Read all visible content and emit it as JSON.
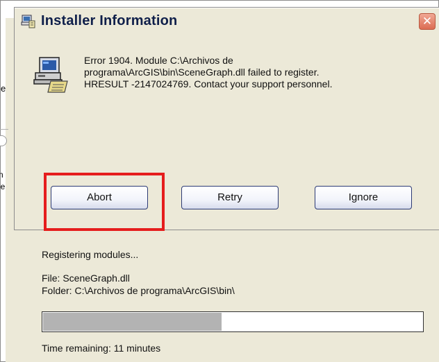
{
  "dialog": {
    "title": "Installer Information",
    "close_glyph": "✕",
    "message": "Error 1904. Module C:\\Archivos de\nprograma\\ArcGIS\\bin\\SceneGraph.dll failed to register.\nHRESULT -2147024769.  Contact your support personnel.",
    "buttons": {
      "abort": "Abort",
      "retry": "Retry",
      "ignore": "Ignore"
    },
    "title_icon": "installer-icon",
    "message_icon": "computer-install-icon"
  },
  "background": {
    "edge_fragments": [
      "e",
      "n",
      "ie"
    ],
    "status": "Registering modules...",
    "file": "File: SceneGraph.dll",
    "folder": "Folder: C:\\Archivos de programa\\ArcGIS\\bin\\",
    "progress_fraction": 0.47,
    "time_remaining": "Time remaining: 11 minutes"
  },
  "colors": {
    "highlight": "#e51d1d",
    "dialog_bg": "#ece9d8",
    "title_text": "#0f1f4a"
  }
}
